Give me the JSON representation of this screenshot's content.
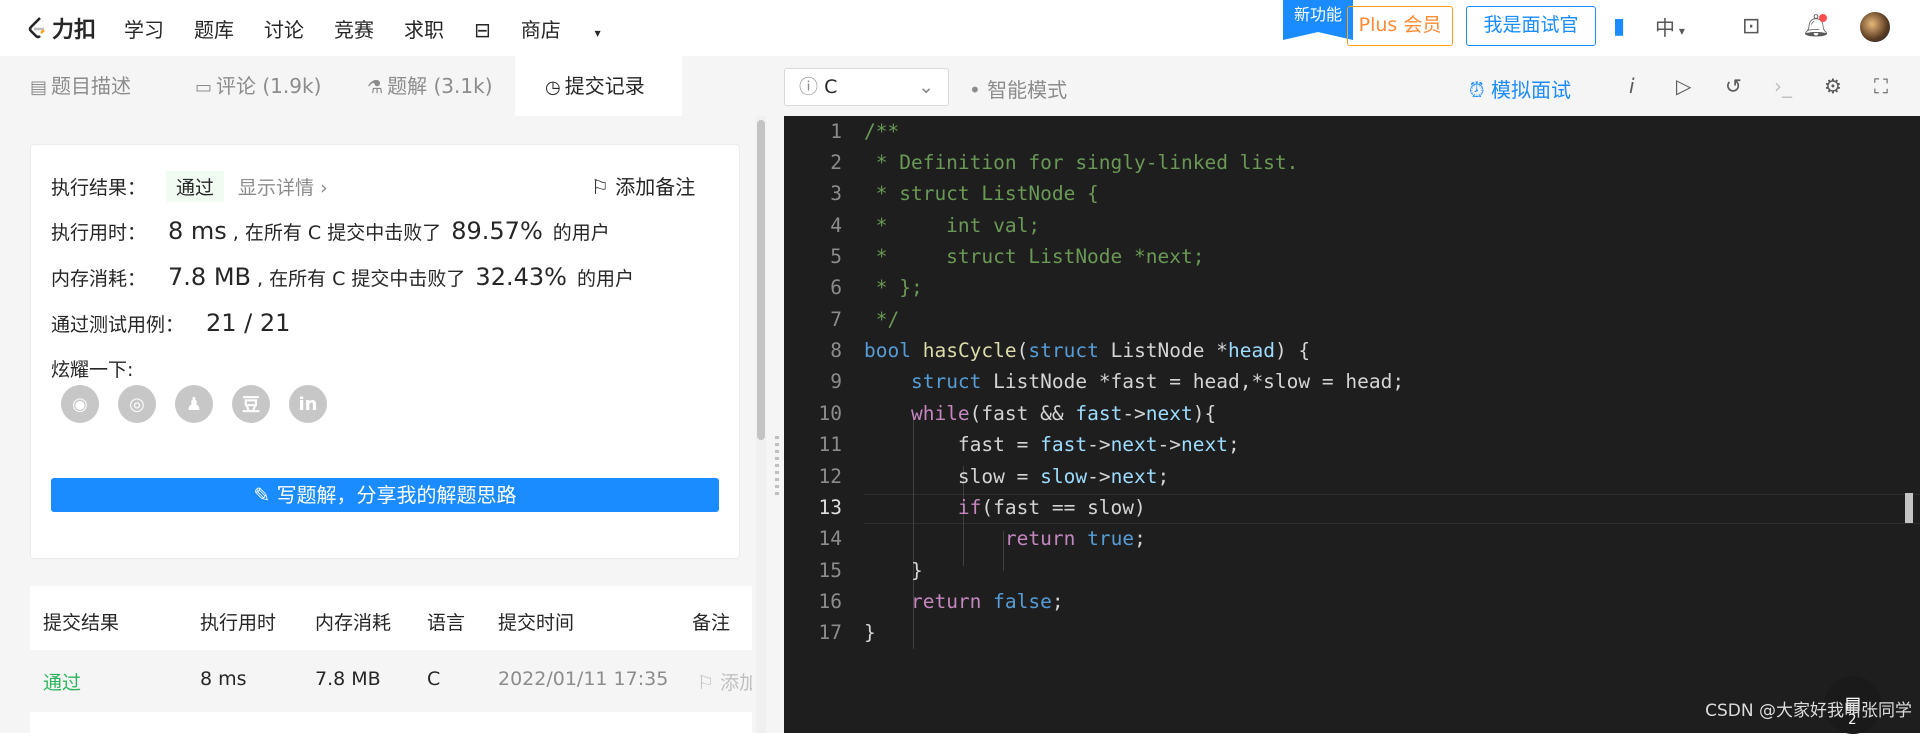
{
  "nav": {
    "logo": "力扣",
    "links": [
      "学习",
      "题库",
      "讨论",
      "竞赛",
      "求职"
    ],
    "shop": "商店",
    "new_feature": "新功能",
    "plus": "Plus 会员",
    "interviewer": "我是面试官",
    "lang": "中"
  },
  "tabs": {
    "desc": "题目描述",
    "comments": "评论 (1.9k)",
    "solutions": "题解 (3.1k)",
    "submissions": "提交记录"
  },
  "result": {
    "label": "执行结果：",
    "status": "通过",
    "detail": "显示详情",
    "add_note": "添加备注",
    "time_label": "执行用时：",
    "time_value": "8 ms",
    "time_text": ", 在所有 C 提交中击败了",
    "time_pct": "89.57%",
    "users": "的用户",
    "mem_label": "内存消耗：",
    "mem_value": "7.8 MB",
    "mem_text": ", 在所有 C 提交中击败了",
    "mem_pct": "32.43%",
    "tests_label": "通过测试用例：",
    "tests_value": "21 / 21",
    "share_label": "炫耀一下:",
    "write_btn": "写题解，分享我的解题思路"
  },
  "table": {
    "headers": [
      "提交结果",
      "执行用时",
      "内存消耗",
      "语言",
      "提交时间",
      "备注"
    ],
    "row": [
      "通过",
      "8 ms",
      "7.8 MB",
      "C",
      "2022/01/11 17:35",
      "添加"
    ]
  },
  "editor": {
    "language": "C",
    "smart_mode": "智能模式",
    "mock_interview": "模拟面试",
    "line_numbers": [
      "1",
      "2",
      "3",
      "4",
      "5",
      "6",
      "7",
      "8",
      "9",
      "10",
      "11",
      "12",
      "13",
      "14",
      "15",
      "16",
      "17"
    ]
  },
  "watermark": "CSDN @大家好我叫张同学",
  "float_count": "2"
}
